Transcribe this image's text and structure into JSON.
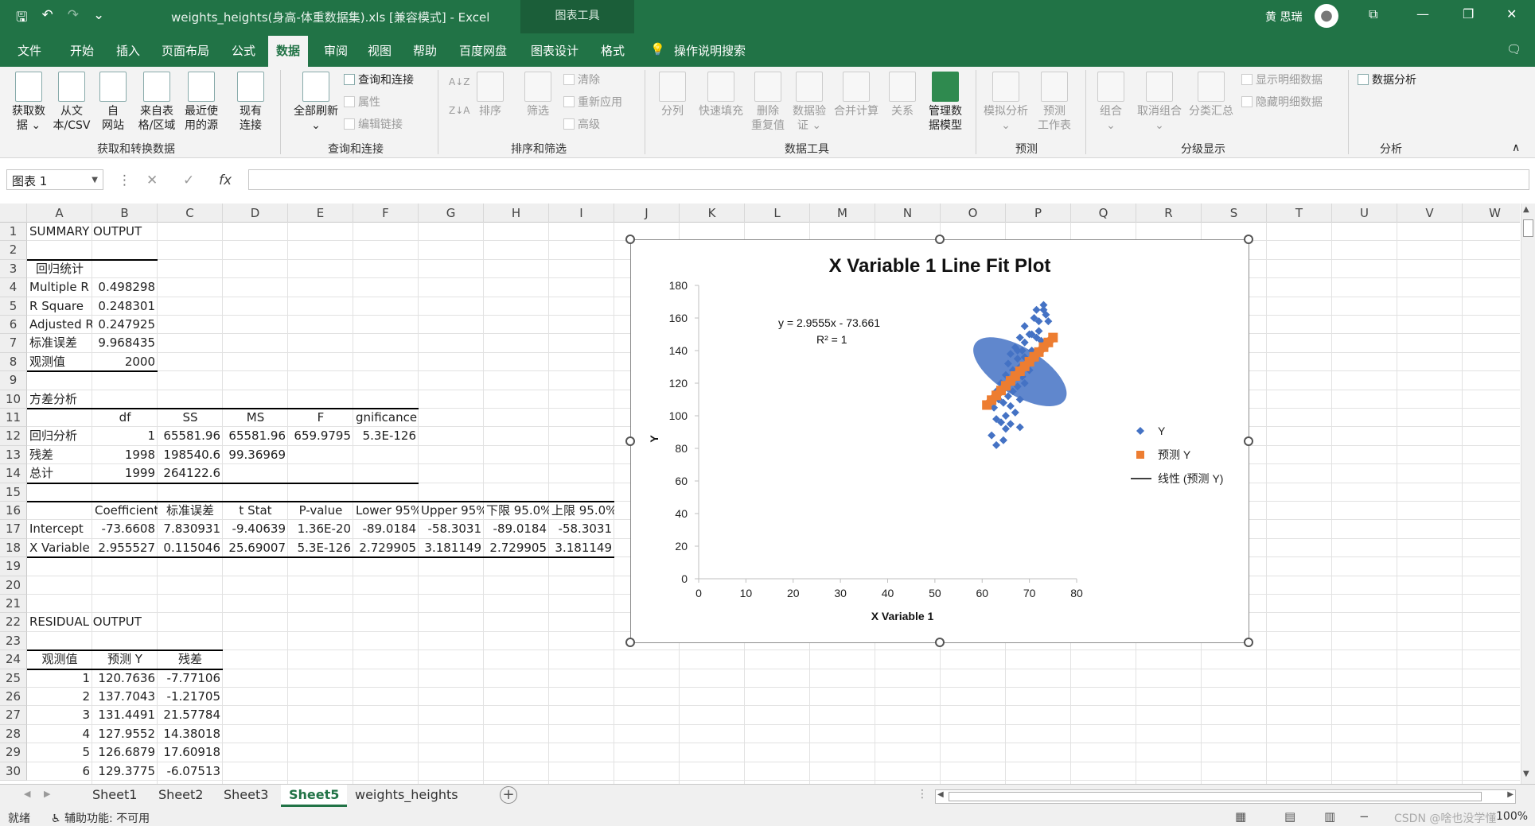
{
  "app": {
    "doc_title": "weights_heights(身高-体重数据集).xls  [兼容模式]  -  Excel",
    "context_label": "图表工具",
    "user_name": "黄 思瑞",
    "qat": {
      "save": "🖫",
      "undo": "↶",
      "redo": "↷",
      "customize": "⌄"
    },
    "win": {
      "ribbon_opts": "⧉",
      "minimize": "—",
      "restore": "❐",
      "close": "✕"
    }
  },
  "tabs": [
    "文件",
    "开始",
    "插入",
    "页面布局",
    "公式",
    "数据",
    "审阅",
    "视图",
    "帮助",
    "百度网盘",
    "图表设计",
    "格式"
  ],
  "active_tab": "数据",
  "tell_me": "操作说明搜索",
  "ribbon": {
    "get_data": "获取数\n据 ⌄",
    "from_csv": "从文\n本/CSV",
    "from_web": "自\n网站",
    "from_table": "来自表\n格/区域",
    "recent_sources": "最近使\n用的源",
    "existing_conn": "现有\n连接",
    "refresh_all": "全部刷新\n⌄",
    "query_conn": "查询和连接",
    "properties": "属性",
    "edit_links": "编辑链接",
    "sort_az": "A↓Z",
    "sort_za": "Z↓A",
    "sort": "排序",
    "filter": "筛选",
    "clear": "清除",
    "reapply": "重新应用",
    "advanced": "高级",
    "text_to_cols": "分列",
    "flash_fill": "快速填充",
    "remove_dup": "删除\n重复值",
    "validation": "数据验\n证 ⌄",
    "consolidate": "合并计算",
    "relationships": "关系",
    "manage_model": "管理数\n据模型",
    "whatif": "模拟分析\n⌄",
    "forecast_sheet": "预测\n工作表",
    "group": "组合\n⌄",
    "ungroup": "取消组合\n⌄",
    "subtotal": "分类汇总",
    "show_detail": "显示明细数据",
    "hide_detail": "隐藏明细数据",
    "data_analysis": "数据分析",
    "groups": [
      "获取和转换数据",
      "查询和连接",
      "排序和筛选",
      "数据工具",
      "预测",
      "分级显示",
      "分析"
    ]
  },
  "formula_bar": {
    "name_box": "图表 1",
    "cancel": "✕",
    "enter": "✓",
    "fx": "fx",
    "content": ""
  },
  "columns": [
    "A",
    "B",
    "C",
    "D",
    "E",
    "F",
    "G",
    "H",
    "I",
    "J",
    "K",
    "L",
    "M",
    "N",
    "O",
    "P",
    "Q",
    "R",
    "S",
    "T",
    "U",
    "V",
    "W"
  ],
  "rows": [
    "1",
    "2",
    "3",
    "4",
    "5",
    "6",
    "7",
    "8",
    "9",
    "10",
    "11",
    "12",
    "13",
    "14",
    "15",
    "16",
    "17",
    "18",
    "19",
    "20",
    "21",
    "22",
    "23",
    "24",
    "25",
    "26",
    "27",
    "28",
    "29",
    "30"
  ],
  "cells": {
    "r1a": "SUMMARY OUTPUT",
    "r3a": "回归统计",
    "r4a": "Multiple R",
    "r4b": "0.498298",
    "r5a": "R Square",
    "r5b": "0.248301",
    "r6a": "Adjusted R",
    "r6b": "0.247925",
    "r7a": "标准误差",
    "r7b": "9.968435",
    "r8a": "观测值",
    "r8b": "2000",
    "r10a": "方差分析",
    "r11b": "df",
    "r11c": "SS",
    "r11d": "MS",
    "r11e": "F",
    "r11f": "gnificance F",
    "r12a": "回归分析",
    "r12b": "1",
    "r12c": "65581.96",
    "r12d": "65581.96",
    "r12e": "659.9795",
    "r12f": "5.3E-126",
    "r13a": "残差",
    "r13b": "1998",
    "r13c": "198540.6",
    "r13d": "99.36969",
    "r14a": "总计",
    "r14b": "1999",
    "r14c": "264122.6",
    "r16b": "Coefficients",
    "r16c": "标准误差",
    "r16d": "t Stat",
    "r16e": "P-value",
    "r16f": "Lower 95%",
    "r16g": "Upper 95%",
    "r16h": "下限 95.0%",
    "r16i": "上限 95.0%",
    "r17a": "Intercept",
    "r17b": "-73.6608",
    "r17c": "7.830931",
    "r17d": "-9.40639",
    "r17e": "1.36E-20",
    "r17f": "-89.0184",
    "r17g": "-58.3031",
    "r17h": "-89.0184",
    "r17i": "-58.3031",
    "r18a": "X Variable",
    "r18b": "2.955527",
    "r18c": "0.115046",
    "r18d": "25.69007",
    "r18e": "5.3E-126",
    "r18f": "2.729905",
    "r18g": "3.181149",
    "r18h": "2.729905",
    "r18i": "3.181149",
    "r22a": "RESIDUAL OUTPUT",
    "r24a": "观测值",
    "r24b": "预测 Y",
    "r24c": "残差",
    "r25a": "1",
    "r25b": "120.7636",
    "r25c": "-7.77106",
    "r26a": "2",
    "r26b": "137.7043",
    "r26c": "-1.21705",
    "r27a": "3",
    "r27b": "131.4491",
    "r27c": "21.57784",
    "r28a": "4",
    "r28b": "127.9552",
    "r28c": "14.38018",
    "r29a": "5",
    "r29b": "126.6879",
    "r29c": "17.60918",
    "r30a": "6",
    "r30b": "129.3775",
    "r30c": "-6.07513"
  },
  "chart_data": {
    "type": "scatter",
    "title": "X Variable 1 Line Fit  Plot",
    "xlabel": "X Variable 1",
    "ylabel": "Y",
    "xlim": [
      0,
      80
    ],
    "ylim": [
      0,
      180
    ],
    "xticks": [
      "0",
      "10",
      "20",
      "30",
      "40",
      "50",
      "60",
      "70",
      "80"
    ],
    "yticks": [
      "0",
      "20",
      "40",
      "60",
      "80",
      "100",
      "120",
      "140",
      "160",
      "180"
    ],
    "grid": false,
    "legend_position": "right",
    "equation": "y = 2.9555x - 73.661",
    "r2_label": "R² = 1",
    "series": [
      {
        "name": "Y",
        "color": "#4472c4",
        "marker": "diamond",
        "x": [
          62,
          62.5,
          63,
          63,
          63.5,
          64,
          64,
          64.5,
          65,
          65,
          65,
          65.5,
          65.5,
          66,
          66,
          66,
          66.5,
          66.5,
          67,
          67,
          67,
          67.5,
          67.5,
          68,
          68,
          68,
          68.5,
          68.5,
          69,
          69,
          69,
          69.5,
          70,
          70,
          70.5,
          71,
          71,
          71.5,
          72,
          72.5,
          73,
          74,
          63,
          64.5,
          66,
          67.5,
          69,
          70.5,
          72,
          73.5,
          71.5,
          73,
          68,
          65
        ],
        "y": [
          88,
          105,
          98,
          115,
          110,
          96,
          120,
          108,
          92,
          118,
          125,
          112,
          132,
          106,
          122,
          138,
          115,
          128,
          102,
          126,
          142,
          118,
          135,
          110,
          130,
          148,
          124,
          140,
          120,
          136,
          155,
          132,
          128,
          150,
          140,
          138,
          160,
          148,
          152,
          146,
          165,
          158,
          82,
          85,
          95,
          140,
          145,
          150,
          158,
          162,
          165,
          168,
          93,
          100
        ]
      },
      {
        "name": "预测 Y",
        "color": "#ed7d31",
        "marker": "square",
        "x": [
          61,
          62,
          63,
          64,
          65,
          66,
          67,
          68,
          69,
          70,
          71,
          72,
          73,
          74,
          75
        ],
        "y": [
          106.6,
          109.6,
          112.5,
          115.5,
          118.4,
          121.4,
          124.4,
          127.3,
          130.3,
          133.2,
          136.2,
          139.1,
          142.1,
          145.0,
          148.0
        ]
      },
      {
        "name": "线性 (预测 Y)",
        "color": "#000000",
        "type": "trendline",
        "x": [
          61,
          75
        ],
        "y": [
          106.6,
          148.0
        ]
      }
    ]
  },
  "sheets": [
    "Sheet1",
    "Sheet2",
    "Sheet3",
    "Sheet5",
    "weights_heights"
  ],
  "active_sheet": "Sheet5",
  "status": {
    "ready": "就绪",
    "accessibility": "辅助功能: 不可用",
    "watermark": "CSDN @啥也没学懂",
    "zoom": "100%"
  }
}
